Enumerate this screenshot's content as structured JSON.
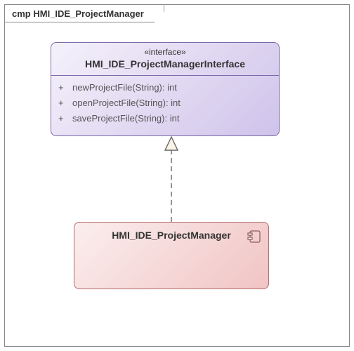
{
  "diagram": {
    "kind_prefix": "cmp",
    "title": "HMI_IDE_ProjectManager"
  },
  "interface": {
    "stereotype": "«interface»",
    "name": "HMI_IDE_ProjectManagerInterface",
    "operations": [
      {
        "visibility": "+",
        "signature": "newProjectFile(String): int"
      },
      {
        "visibility": "+",
        "signature": "openProjectFile(String): int"
      },
      {
        "visibility": "+",
        "signature": "saveProjectFile(String): int"
      }
    ]
  },
  "component": {
    "name": "HMI_IDE_ProjectManager"
  },
  "relationship": {
    "type": "realization",
    "from": "HMI_IDE_ProjectManager",
    "to": "HMI_IDE_ProjectManagerInterface"
  }
}
